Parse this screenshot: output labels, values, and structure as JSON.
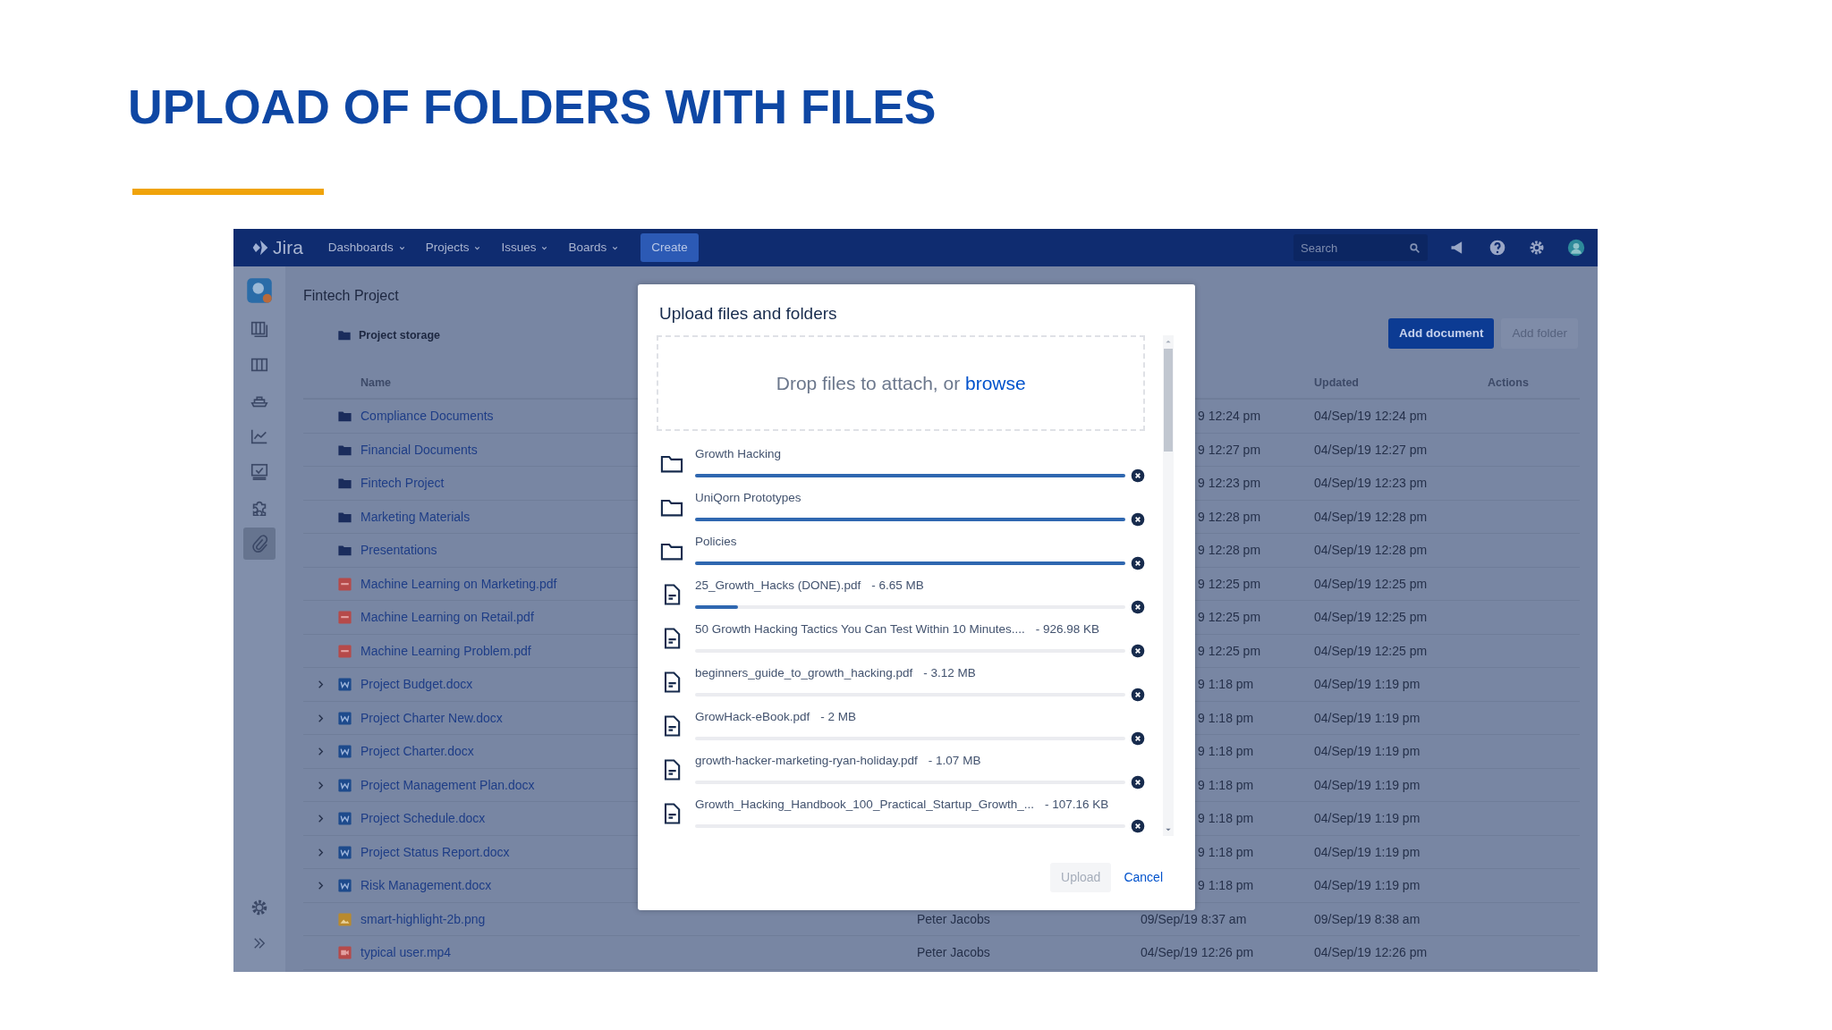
{
  "slide": {
    "title": "UPLOAD OF FOLDERS WITH FILES"
  },
  "navbar": {
    "logo": "Jira",
    "menus": [
      {
        "label": "Dashboards"
      },
      {
        "label": "Projects"
      },
      {
        "label": "Issues"
      },
      {
        "label": "Boards"
      }
    ],
    "create": "Create",
    "search": {
      "placeholder": "Search"
    }
  },
  "sidebar": {
    "items": [
      {
        "kind": "board",
        "selected": false
      },
      {
        "kind": "columns",
        "selected": false
      },
      {
        "kind": "ship",
        "selected": false
      },
      {
        "kind": "chart",
        "selected": false
      },
      {
        "kind": "monitor",
        "selected": false
      },
      {
        "kind": "puzzle",
        "selected": false
      },
      {
        "kind": "paperclip",
        "selected": true
      }
    ]
  },
  "project": {
    "name": "Fintech Project",
    "storage": "Project storage"
  },
  "actions": {
    "add_document": "Add document",
    "add_folder": "Add folder"
  },
  "table": {
    "columns": {
      "name": "Name",
      "updated": "Updated",
      "actions": "Actions"
    },
    "rows": [
      {
        "kind": "folder",
        "expandable": false,
        "name": "Compliance Documents",
        "created": "9 12:24 pm",
        "updated": "04/Sep/19 12:24 pm"
      },
      {
        "kind": "folder",
        "expandable": false,
        "name": "Financial Documents",
        "created": "9 12:27 pm",
        "updated": "04/Sep/19 12:27 pm"
      },
      {
        "kind": "folder",
        "expandable": false,
        "name": "Fintech Project",
        "created": "9 12:23 pm",
        "updated": "04/Sep/19 12:23 pm"
      },
      {
        "kind": "folder",
        "expandable": false,
        "name": "Marketing Materials",
        "created": "9 12:28 pm",
        "updated": "04/Sep/19 12:28 pm"
      },
      {
        "kind": "folder",
        "expandable": false,
        "name": "Presentations",
        "created": "9 12:28 pm",
        "updated": "04/Sep/19 12:28 pm"
      },
      {
        "kind": "pdf",
        "expandable": false,
        "name": "Machine Learning on Marketing.pdf",
        "created": "9 12:25 pm",
        "updated": "04/Sep/19 12:25 pm"
      },
      {
        "kind": "pdf",
        "expandable": false,
        "name": "Machine Learning on Retail.pdf",
        "created": "9 12:25 pm",
        "updated": "04/Sep/19 12:25 pm"
      },
      {
        "kind": "pdf",
        "expandable": false,
        "name": "Machine Learning Problem.pdf",
        "created": "9 12:25 pm",
        "updated": "04/Sep/19 12:25 pm"
      },
      {
        "kind": "doc",
        "expandable": true,
        "name": "Project Budget.docx",
        "created": "9 1:18 pm",
        "updated": "04/Sep/19 1:19 pm"
      },
      {
        "kind": "doc",
        "expandable": true,
        "name": "Project Charter New.docx",
        "created": "9 1:18 pm",
        "updated": "04/Sep/19 1:19 pm"
      },
      {
        "kind": "doc",
        "expandable": true,
        "name": "Project Charter.docx",
        "created": "9 1:18 pm",
        "updated": "04/Sep/19 1:19 pm"
      },
      {
        "kind": "doc",
        "expandable": true,
        "name": "Project Management Plan.docx",
        "created": "9 1:18 pm",
        "updated": "04/Sep/19 1:19 pm"
      },
      {
        "kind": "doc",
        "expandable": true,
        "name": "Project Schedule.docx",
        "created": "9 1:18 pm",
        "updated": "04/Sep/19 1:19 pm"
      },
      {
        "kind": "doc",
        "expandable": true,
        "name": "Project Status Report.docx",
        "created": "9 1:18 pm",
        "updated": "04/Sep/19 1:19 pm"
      },
      {
        "kind": "doc",
        "expandable": true,
        "name": "Risk Management.docx",
        "created": "9 1:18 pm",
        "updated": "04/Sep/19 1:19 pm"
      },
      {
        "kind": "image",
        "expandable": false,
        "name": "smart-highlight-2b.png",
        "owner": "Peter Jacobs",
        "created": "09/Sep/19 8:37 am",
        "updated": "09/Sep/19 8:38 am"
      },
      {
        "kind": "video",
        "expandable": false,
        "name": "typical user.mp4",
        "owner": "Peter Jacobs",
        "created": "04/Sep/19 12:26 pm",
        "updated": "04/Sep/19 12:26 pm"
      }
    ]
  },
  "dialog": {
    "title": "Upload files and folders",
    "drop_text": "Drop files to attach, or",
    "browse": "browse",
    "items": [
      {
        "kind": "folder",
        "name": "Growth Hacking",
        "level": 1
      },
      {
        "kind": "folder",
        "name": "UniQorn Prototypes",
        "level": 1
      },
      {
        "kind": "folder",
        "name": "Policies",
        "level": 1
      },
      {
        "kind": "file",
        "name": "25_Growth_Hacks (DONE).pdf",
        "size": "- 6.65 MB",
        "level": 0.1
      },
      {
        "kind": "file",
        "name": "50 Growth Hacking Tactics You Can Test Within 10 Minutes....",
        "size": "- 926.98 KB",
        "level": 0
      },
      {
        "kind": "file",
        "name": "beginners_guide_to_growth_hacking.pdf",
        "size": "- 3.12 MB",
        "level": 0
      },
      {
        "kind": "file",
        "name": "GrowHack-eBook.pdf",
        "size": "- 2 MB",
        "level": 0
      },
      {
        "kind": "file",
        "name": "growth-hacker-marketing-ryan-holiday.pdf",
        "size": "- 1.07 MB",
        "level": 0
      },
      {
        "kind": "file",
        "name": "Growth_Hacking_Handbook_100_Practical_Startup_Growth_...",
        "size": "- 107.16 KB",
        "level": 0
      }
    ],
    "upload": {
      "label": "Upload",
      "disabled": true
    },
    "cancel": "Cancel"
  }
}
